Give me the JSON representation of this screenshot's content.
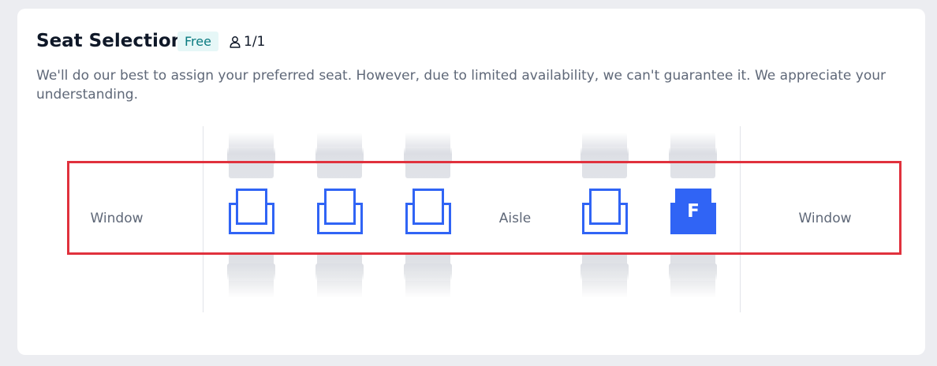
{
  "section": {
    "title": "Seat Selection",
    "badge": "Free",
    "passenger_count": "1/1",
    "description": "We'll do our best to assign your preferred seat. However, due to limited availability, we can't guarantee it. We appreciate your understanding."
  },
  "seat_map": {
    "left_label": "Window",
    "aisle_label": "Aisle",
    "right_label": "Window",
    "seats": [
      {
        "status": "available",
        "letter": ""
      },
      {
        "status": "available",
        "letter": ""
      },
      {
        "status": "available",
        "letter": ""
      },
      {
        "status": "available",
        "letter": ""
      },
      {
        "status": "selected",
        "letter": "F"
      }
    ]
  },
  "colors": {
    "accent": "#3064f5",
    "highlight_border": "#e0313d",
    "badge_bg": "#e6f7f7",
    "badge_text": "#0a7b80"
  },
  "icons": {
    "passenger": "person-icon",
    "seat": "seat-icon"
  }
}
